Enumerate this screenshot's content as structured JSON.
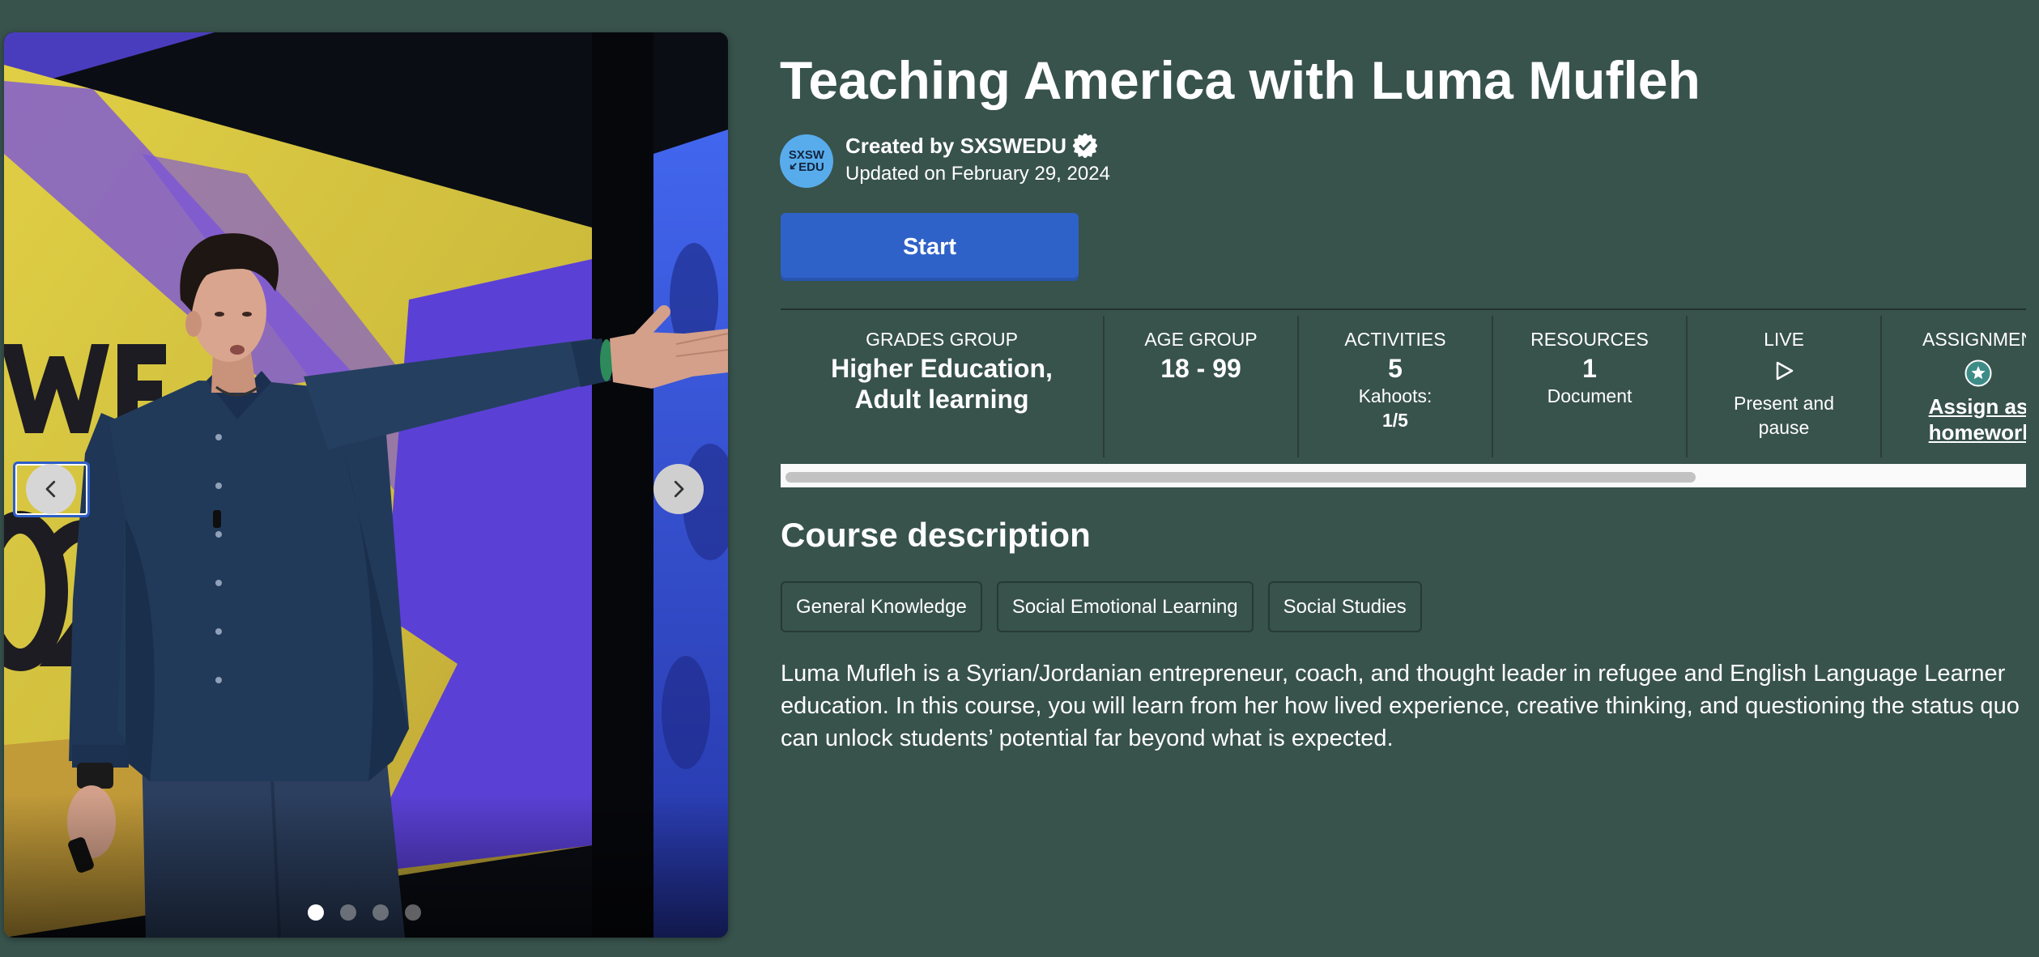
{
  "course": {
    "title": "Teaching America with Luma Mufleh",
    "created_by": "Created by SXSWEDU",
    "updated": "Updated on February 29, 2024",
    "avatar_logo_line1": "SXSW",
    "avatar_logo_line2": "EDU",
    "verified_icon": "verified-badge-icon"
  },
  "cover": {
    "slide_count": 4,
    "active_slide": 1,
    "prev_icon": "chevron-left-icon",
    "next_icon": "chevron-right-icon"
  },
  "actions": {
    "start_label": "Start"
  },
  "stats": {
    "grades": {
      "label": "GRADES GROUP",
      "value_lines": [
        "Higher Education,",
        "Adult learning"
      ]
    },
    "age": {
      "label": "AGE GROUP",
      "value": "18 - 99"
    },
    "activities": {
      "label": "ACTIVITIES",
      "value": "5",
      "sub_label": "Kahoots:",
      "sub_value": "1/5"
    },
    "resources": {
      "label": "RESOURCES",
      "value": "1",
      "sub_label": "Document"
    },
    "live": {
      "label": "LIVE",
      "icon": "play-outline-icon",
      "sub_lines": [
        "Present and",
        "pause"
      ]
    },
    "assignment": {
      "label": "ASSIGNMEN",
      "icon": "star-circle-icon",
      "link_lines": [
        "Assign as",
        "homeworl"
      ]
    }
  },
  "description": {
    "heading": "Course description",
    "tags": [
      "General Knowledge",
      "Social Emotional Learning",
      "Social Studies"
    ],
    "text": "Luma Mufleh is a Syrian/Jordanian entrepreneur, coach, and thought leader in refugee and English Language Learner education. In this course, you will learn from her how lived experience, creative thinking, and questioning the status quo can unlock students’ potential far beyond what is expected."
  },
  "colors": {
    "background": "#38524c",
    "primary_button": "#2f62c8",
    "avatar": "#58acec"
  }
}
